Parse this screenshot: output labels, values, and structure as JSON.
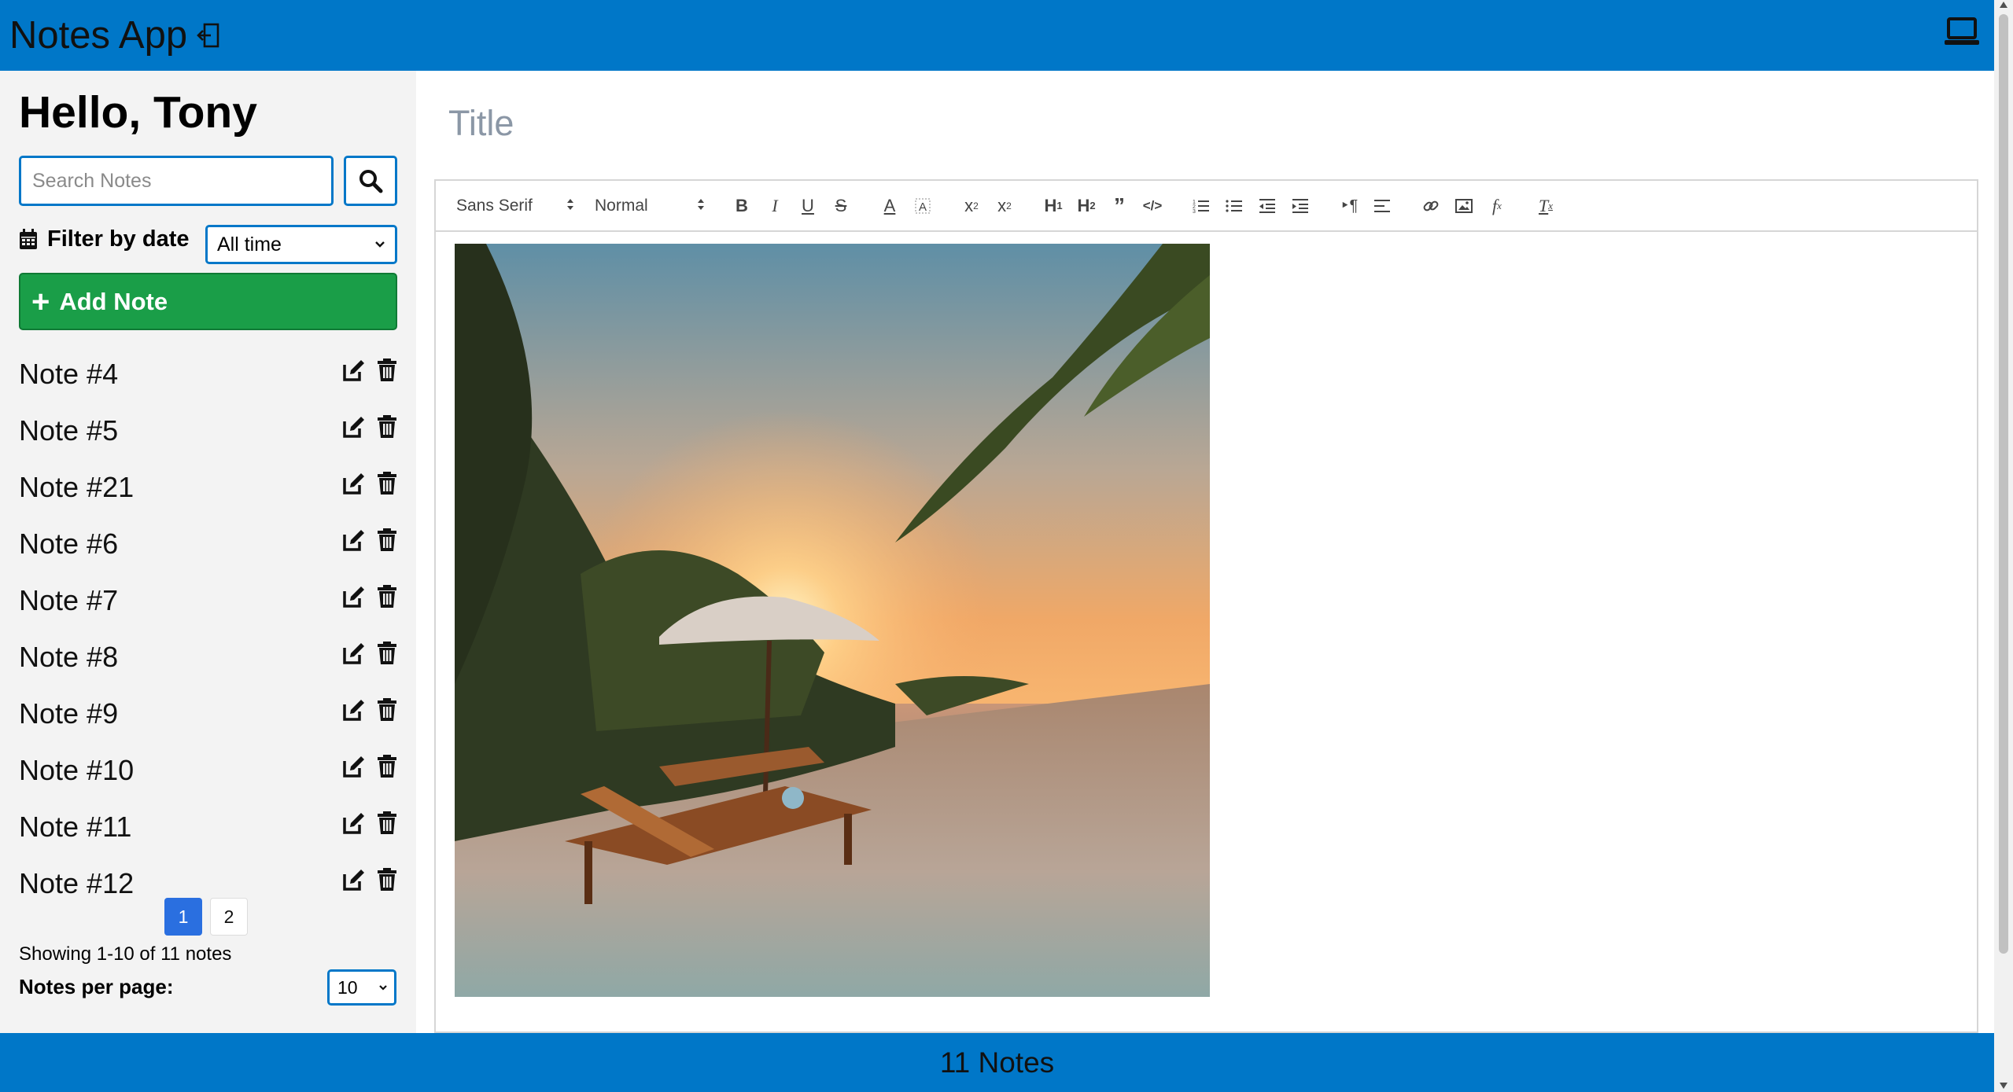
{
  "header": {
    "title": "Notes App",
    "logout_icon": "logout-icon",
    "laptop_icon": "laptop-icon"
  },
  "sidebar": {
    "greeting": "Hello, Tony",
    "search_placeholder": "Search Notes",
    "filter_label": "Filter by date",
    "filter_value": "All time",
    "add_note_label": "Add Note",
    "notes": [
      {
        "title": "Note #4"
      },
      {
        "title": "Note #5"
      },
      {
        "title": "Note #21"
      },
      {
        "title": "Note #6"
      },
      {
        "title": "Note #7"
      },
      {
        "title": "Note #8"
      },
      {
        "title": "Note #9"
      },
      {
        "title": "Note #10"
      },
      {
        "title": "Note #11"
      },
      {
        "title": "Note #12"
      }
    ],
    "pages": [
      "1",
      "2"
    ],
    "current_page": "1",
    "showing_text": "Showing 1-10 of 11 notes",
    "per_page_label": "Notes per page:",
    "per_page_value": "10"
  },
  "editor": {
    "title_placeholder": "Title",
    "font_value": "Sans Serif",
    "size_value": "Normal",
    "toolbar_icons": [
      "bold-icon",
      "italic-icon",
      "underline-icon",
      "strike-icon",
      "text-color-icon",
      "background-color-icon",
      "superscript-icon",
      "subscript-icon",
      "header1-icon",
      "header2-icon",
      "blockquote-icon",
      "code-block-icon",
      "ordered-list-icon",
      "bullet-list-icon",
      "outdent-icon",
      "indent-icon",
      "rtl-direction-icon",
      "align-icon",
      "link-icon",
      "image-icon",
      "formula-icon",
      "clean-format-icon"
    ]
  },
  "footer": {
    "count_text": "11 Notes"
  },
  "colors": {
    "primary": "#0077c8",
    "add_button": "#1a9e48",
    "active_page": "#2a6fe0"
  }
}
